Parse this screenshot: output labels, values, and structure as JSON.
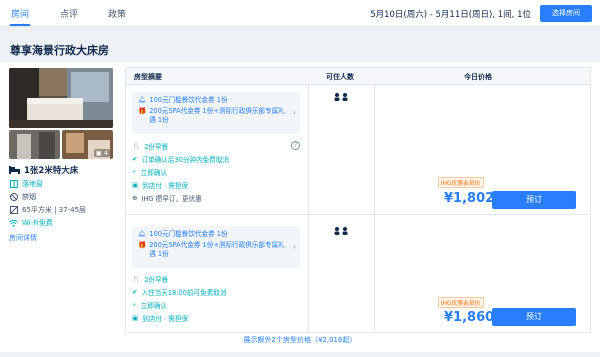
{
  "tabs": [
    {
      "label": "房间",
      "active": true
    },
    {
      "label": "点评",
      "active": false
    },
    {
      "label": "政策",
      "active": false
    }
  ],
  "date_range": "5月10日(周六) - 5月11日(周日), 1间, 1位",
  "choose_room_label": "选择房间",
  "room_name": "尊享海景行政大床房",
  "photo_count": "4",
  "room_info": {
    "bed": "1张2米特大床",
    "features": [
      {
        "icon": "window-icon",
        "label": "落地窗",
        "color": "#06aebd"
      },
      {
        "icon": "no-smoking-icon",
        "label": "禁烟",
        "color": "#455873"
      },
      {
        "icon": "area-icon",
        "label": "65平方米 | 37-45层",
        "color": "#455873"
      },
      {
        "icon": "wifi-icon",
        "label": "Wi-Fi免费",
        "color": "#06aebd"
      }
    ],
    "detail_link": "房间详情"
  },
  "table_headers": {
    "summary": "房型摘要",
    "occupancy": "可住人数",
    "price": "今日价格"
  },
  "rates": [
    {
      "package": [
        {
          "icon": "bell-icon",
          "text": "100元门槛餐饮代金券 1份"
        },
        {
          "icon": "gift-icon",
          "text": "200元SPA代金券 1份+测际行政俱乐部专属礼遇 1份"
        }
      ],
      "benefits": [
        {
          "icon": "fork-knife-icon",
          "text": "2份早餐",
          "color": "#06aebd"
        },
        {
          "icon": "check-circle-icon",
          "text": "订单确认后30分钟内免费取消",
          "color": "#06aebd"
        },
        {
          "icon": "lightning-icon",
          "text": "立即确认",
          "color": "#06aebd"
        },
        {
          "icon": "wallet-icon",
          "text": "到店付 · 需担保",
          "color": "#06aebd"
        },
        {
          "icon": "plus-circle-icon",
          "text": "IHG 攒早订，更优惠",
          "color": "#455873"
        }
      ],
      "help": "?",
      "occupancy": "●● ",
      "tag": "IHG优惠会员价",
      "price": "¥1,802",
      "book_label": "预订"
    },
    {
      "package": [
        {
          "icon": "bell-icon",
          "text": "100元门槛餐饮代金券 1份"
        },
        {
          "icon": "gift-icon",
          "text": "200元SPA代金券 1份+测际行政俱乐部专属礼遇 1份"
        }
      ],
      "benefits": [
        {
          "icon": "fork-knife-icon",
          "text": "2份早餐",
          "color": "#06aebd"
        },
        {
          "icon": "check-circle-icon",
          "text": "入住当天18:00前可免费取消",
          "color": "#06aebd"
        },
        {
          "icon": "lightning-icon",
          "text": "立即确认",
          "color": "#06aebd"
        },
        {
          "icon": "wallet-icon",
          "text": "到店付 · 需担保",
          "color": "#06aebd"
        }
      ],
      "occupancy": "●● ",
      "tag": "IHG优惠会员价",
      "price": "¥1,860",
      "book_label": "预订"
    }
  ],
  "more_link": "展示额外2个房型价格（¥2,016起）",
  "colors": {
    "accent": "#287dfa",
    "green": "#06aebd",
    "orange": "#ff6f00"
  }
}
